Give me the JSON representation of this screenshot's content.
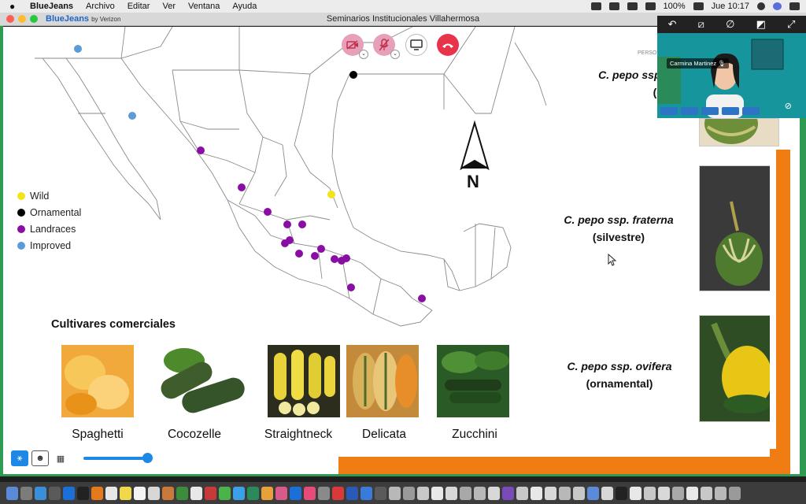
{
  "menubar": {
    "app": "BlueJeans",
    "items": [
      "Archivo",
      "Editar",
      "Ver",
      "Ventana",
      "Ayuda"
    ],
    "battery": "100%",
    "clock": "Jue 10:17"
  },
  "window": {
    "brand": "BlueJeans",
    "brand_sub": "by Verizon",
    "title": "Seminarios Institucionales Villahermosa"
  },
  "video": {
    "participant": "Carmina Martinez",
    "person_label": "PERSO"
  },
  "legend": [
    {
      "label": "Wild",
      "color": "#f3e31b"
    },
    {
      "label": "Ornamental",
      "color": "#000000"
    },
    {
      "label": "Landraces",
      "color": "#8a0ea3"
    },
    {
      "label": "Improved",
      "color": "#5b9bd8"
    }
  ],
  "north_label": "N",
  "species": [
    {
      "name": "C. pepo ssp. p",
      "common": "(criollas)"
    },
    {
      "name": "C. pepo ssp. fraterna",
      "common": "(silvestre)"
    },
    {
      "name": "C. pepo ssp. ovifera",
      "common": "(ornamental)"
    }
  ],
  "cultivars_title": "Cultivares comerciales",
  "cultivars": [
    "Spaghetti",
    "Cocozelle",
    "Straightneck",
    "Delicata",
    "Zucchini"
  ],
  "colors": {
    "accent_orange": "#f07c14",
    "frame_green": "#2e9a52",
    "hangup_red": "#e8344b",
    "control_pink": "#e7a0b9"
  }
}
